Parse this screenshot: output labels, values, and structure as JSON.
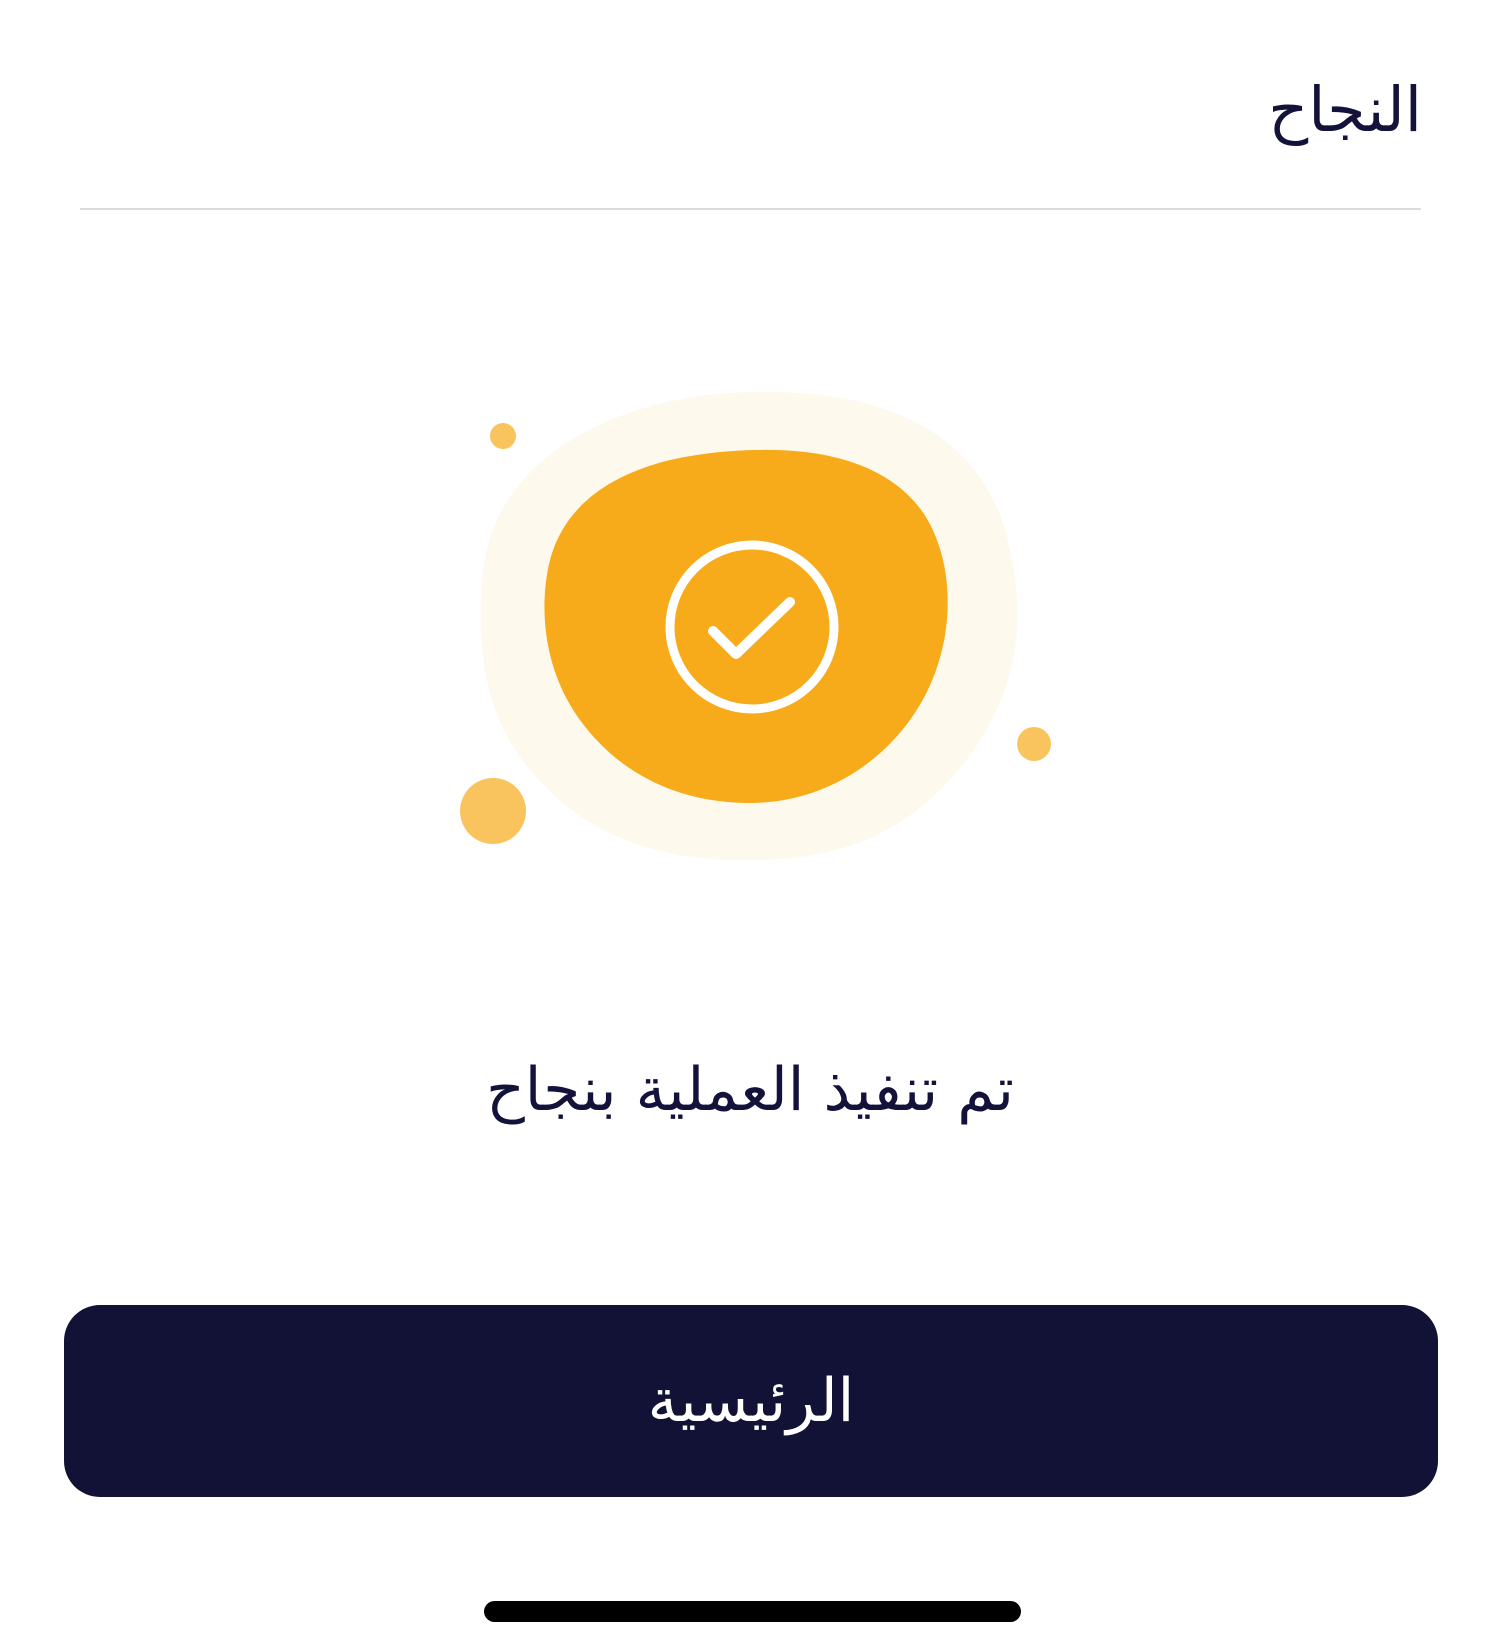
{
  "header": {
    "title": "النجاح"
  },
  "illustration": {
    "icon": "check-circle-icon",
    "colors": {
      "blob_outer": "#fef9ed",
      "blob_inner": "#f7ab1b",
      "dots": "#f9c45e",
      "check": "#ffffff"
    }
  },
  "main": {
    "message": "تم تنفيذ العملية بنجاح"
  },
  "actions": {
    "home_label": "الرئيسية"
  },
  "theme": {
    "primary": "#111236",
    "text": "#12123a",
    "accent": "#f7ab1b"
  }
}
